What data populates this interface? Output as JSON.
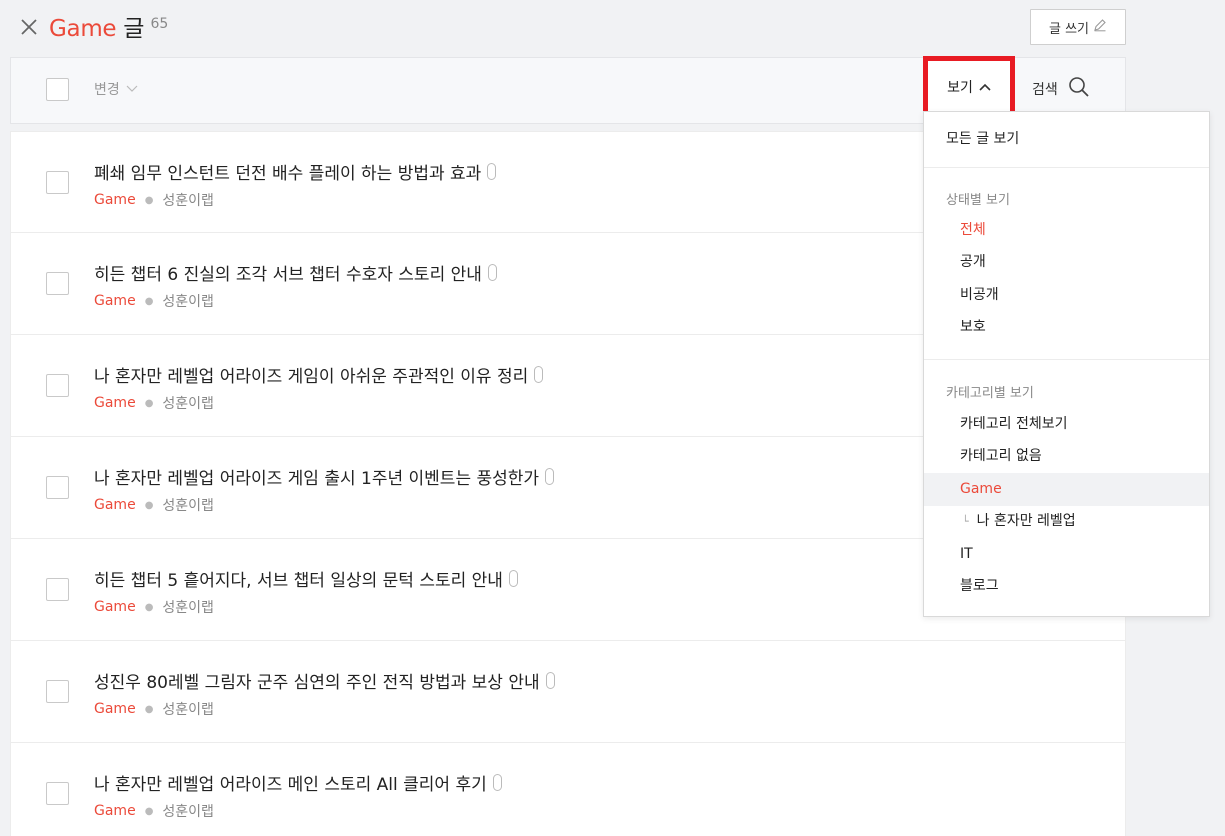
{
  "header": {
    "category": "Game",
    "title_suffix": "글",
    "count": "65",
    "write_label": "글 쓰기"
  },
  "toolbar": {
    "change_label": "변경",
    "view_label": "보기",
    "search_label": "검색"
  },
  "posts": [
    {
      "title": "폐쇄 임무 인스턴트 던전 배수 플레이 하는 방법과 효과",
      "category": "Game",
      "author": "성훈이랩"
    },
    {
      "title": "히든 챕터 6 진실의 조각 서브 챕터 수호자 스토리 안내",
      "category": "Game",
      "author": "성훈이랩"
    },
    {
      "title": "나 혼자만 레벨업 어라이즈 게임이 아쉬운 주관적인 이유 정리",
      "category": "Game",
      "author": "성훈이랩"
    },
    {
      "title": "나 혼자만 레벨업 어라이즈 게임 출시 1주년 이벤트는 풍성한가",
      "category": "Game",
      "author": "성훈이랩"
    },
    {
      "title": "히든 챕터 5 흩어지다, 서브 챕터 일상의 문턱 스토리 안내",
      "category": "Game",
      "author": "성훈이랩"
    },
    {
      "title": "성진우 80레벨 그림자 군주 심연의 주인 전직 방법과 보상 안내",
      "category": "Game",
      "author": "성훈이랩"
    },
    {
      "title": "나 혼자만 레벨업 어라이즈 메인 스토리 All 클리어 후기",
      "category": "Game",
      "author": "성훈이랩"
    }
  ],
  "dropdown": {
    "all_posts": "모든 글 보기",
    "status_heading": "상태별 보기",
    "status_items": [
      "전체",
      "공개",
      "비공개",
      "보호"
    ],
    "status_active": "전체",
    "category_heading": "카테고리별 보기",
    "category_items": [
      "카테고리 전체보기",
      "카테고리 없음",
      "Game"
    ],
    "category_active": "Game",
    "sub_category": "나 혼자만 레벨업",
    "category_items_after": [
      "IT",
      "블로그"
    ]
  },
  "colors": {
    "accent": "#eb4a3a",
    "highlight_box": "#e81b23"
  }
}
